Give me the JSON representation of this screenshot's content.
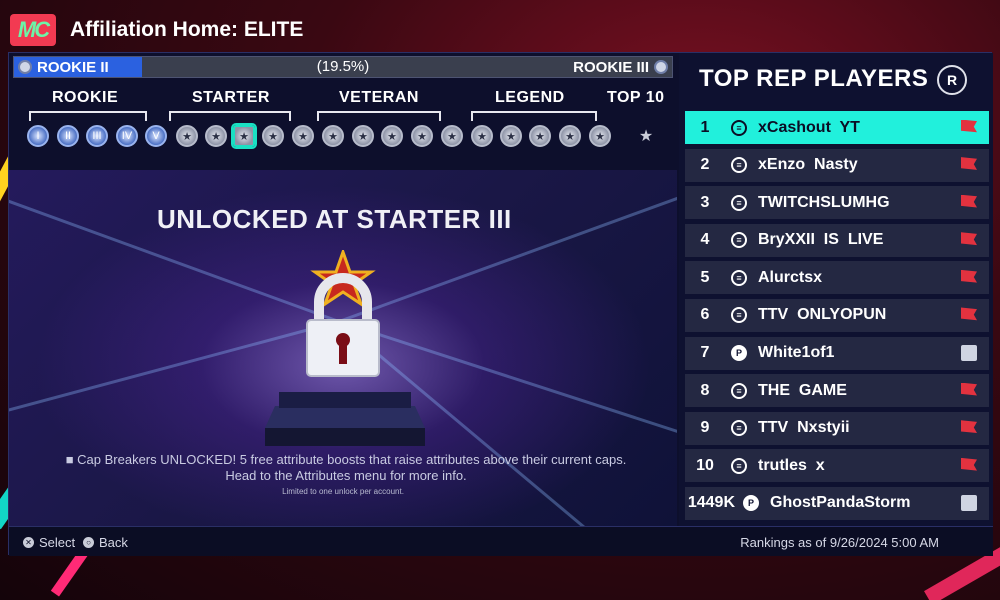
{
  "header": {
    "logo_text": "MC",
    "title": "Affiliation Home: ELITE"
  },
  "progress": {
    "current_rank": "ROOKIE II",
    "percent_label": "(19.5%)",
    "percent": 19.5,
    "next_rank": "ROOKIE III"
  },
  "tiers": [
    {
      "label": "ROOKIE"
    },
    {
      "label": "STARTER"
    },
    {
      "label": "VETERAN"
    },
    {
      "label": "LEGEND"
    },
    {
      "label": "TOP 10"
    }
  ],
  "tier_badges": {
    "rookie_count": 5,
    "starter_count": 5,
    "veteran_count": 5,
    "legend_count": 5,
    "current_badge_index": 7,
    "track_progress_steps": 2
  },
  "feature": {
    "title": "UNLOCKED AT STARTER III",
    "description_line1": "Cap Breakers UNLOCKED! 5 free attribute boosts that raise attributes above their current caps.",
    "description_line2": "Head to the Attributes menu for more info.",
    "fine_print": "Limited to one unlock per account."
  },
  "leaderboard": {
    "title": "TOP REP PLAYERS",
    "r_button": "R",
    "rows": [
      {
        "rank": "1",
        "platform": "xbox",
        "gamertag": "xCashout  YT",
        "badge": "flag",
        "active": true
      },
      {
        "rank": "2",
        "platform": "xbox",
        "gamertag": "xEnzo  Nasty",
        "badge": "flag",
        "active": false
      },
      {
        "rank": "3",
        "platform": "xbox",
        "gamertag": "TWITCHSLUMHG",
        "badge": "flag",
        "active": false
      },
      {
        "rank": "4",
        "platform": "xbox",
        "gamertag": "BryXXII  IS  LIVE",
        "badge": "flag",
        "active": false
      },
      {
        "rank": "5",
        "platform": "xbox",
        "gamertag": "Alurctsx",
        "badge": "flag",
        "active": false
      },
      {
        "rank": "6",
        "platform": "xbox",
        "gamertag": "TTV  ONLYOPUN",
        "badge": "flag",
        "active": false
      },
      {
        "rank": "7",
        "platform": "playstation",
        "gamertag": "White1of1",
        "badge": "medal",
        "active": false
      },
      {
        "rank": "8",
        "platform": "xbox",
        "gamertag": "THE  GAME",
        "badge": "flag",
        "active": false
      },
      {
        "rank": "9",
        "platform": "xbox",
        "gamertag": "TTV  Nxstyii",
        "badge": "flag",
        "active": false
      },
      {
        "rank": "10",
        "platform": "xbox",
        "gamertag": "trutles  x",
        "badge": "flag",
        "active": false
      },
      {
        "rank": "1449K",
        "platform": "playstation",
        "gamertag": "GhostPandaStorm",
        "badge": "medal",
        "active": false
      }
    ]
  },
  "footer": {
    "select_label": "Select",
    "back_label": "Back",
    "rankings_time": "Rankings as of 9/26/2024 5:00 AM"
  },
  "colors": {
    "accent_teal": "#21f0dc",
    "progress_blue": "#2b61e0",
    "logo_red": "#f23a52",
    "rank_flag_red": "#e2323f"
  }
}
